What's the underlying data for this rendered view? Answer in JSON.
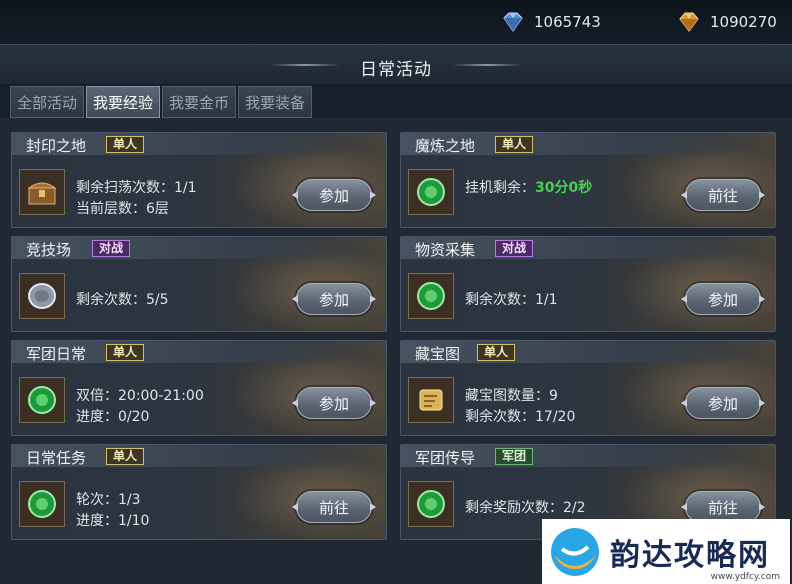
{
  "currency": {
    "diamond": "1065743",
    "gold": "1090270"
  },
  "header": {
    "title": "日常活动"
  },
  "tabs": [
    {
      "label": "全部活动",
      "active": false
    },
    {
      "label": "我要经验",
      "active": true
    },
    {
      "label": "我要金币",
      "active": false
    },
    {
      "label": "我要装备",
      "active": false
    }
  ],
  "cards": [
    {
      "name": "封印之地",
      "badge": "单人",
      "lines": [
        "剩余扫荡次数：1/1",
        "当前层数：6层"
      ],
      "button": "参加"
    },
    {
      "name": "魔炼之地",
      "badge": "单人",
      "line_label": "挂机剩余：",
      "line_value": "30分0秒",
      "button": "前往"
    },
    {
      "name": "竞技场",
      "badge": "对战",
      "lines": [
        "剩余次数：5/5"
      ],
      "button": "参加"
    },
    {
      "name": "物资采集",
      "badge": "对战",
      "lines": [
        "剩余次数：1/1"
      ],
      "button": "参加"
    },
    {
      "name": "军团日常",
      "badge": "单人",
      "lines": [
        "双倍：20:00-21:00",
        "进度：0/20"
      ],
      "button": "参加"
    },
    {
      "name": "藏宝图",
      "badge": "单人",
      "lines": [
        "藏宝图数量：9",
        "剩余次数：17/20"
      ],
      "button": "参加"
    },
    {
      "name": "日常任务",
      "badge": "单人",
      "lines": [
        "轮次：1/3",
        "进度：1/10"
      ],
      "button": "前往"
    },
    {
      "name": "军团传导",
      "badge": "军团",
      "lines": [
        "剩余奖励次数：2/2"
      ],
      "button": "前往"
    }
  ],
  "watermark": {
    "name": "韵达攻略网",
    "url": "www.ydfcy.com"
  },
  "icons": {
    "diamond": "diamond-gem-icon",
    "gold": "gold-gem-icon",
    "chest": "treasure-chest-icon",
    "jade": "green-jade-icon",
    "coin": "silver-coin-icon",
    "scroll": "treasure-map-icon"
  }
}
